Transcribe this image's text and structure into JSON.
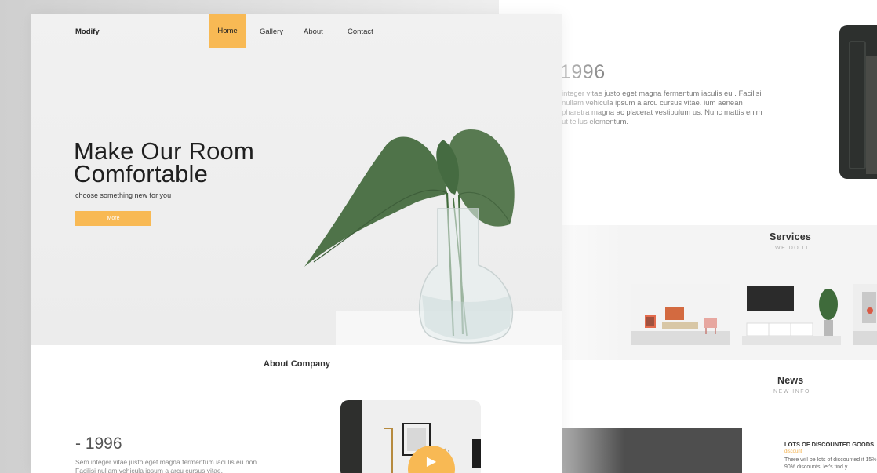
{
  "right_page": {
    "year": "1996",
    "paragraph": "integer vitae justo eget magna fermentum iaculis eu . Facilisi nullam vehicula ipsum a arcu cursus vitae. ium aenean pharetra magna ac placerat vestibulum us. Nunc mattis enim ut tellus elementum.",
    "services": {
      "title": "Services",
      "subtitle": "WE DO IT"
    },
    "news": {
      "title": "News",
      "subtitle": "NEW INFO",
      "item_title": "LOTS OF DISCOUNTED GOODS",
      "item_tag": "discount",
      "item_text": "There will be lots of discounted it 15% to 90% discounts, let's find y"
    }
  },
  "main_page": {
    "logo": "Modify",
    "nav": [
      {
        "label": "Home",
        "active": true
      },
      {
        "label": "Gallery",
        "active": false
      },
      {
        "label": "About",
        "active": false
      },
      {
        "label": "Contact",
        "active": false
      }
    ],
    "hero": {
      "title": "Make Our Room\nComfortable",
      "subtitle": "choose something new for you",
      "button": "More"
    },
    "about": {
      "title": "About Company",
      "year": "- 1996",
      "text": "Sem integer vitae justo eget magna fermentum iaculis eu non. Facilisi nullam vehicula ipsum a arcu cursus vitae."
    }
  },
  "colors": {
    "accent": "#f8b954",
    "leaf": "#4a6e45",
    "text_dark": "#1f1f1f",
    "hero_bg": "#efefef"
  },
  "icons": {
    "play": "play-icon"
  }
}
